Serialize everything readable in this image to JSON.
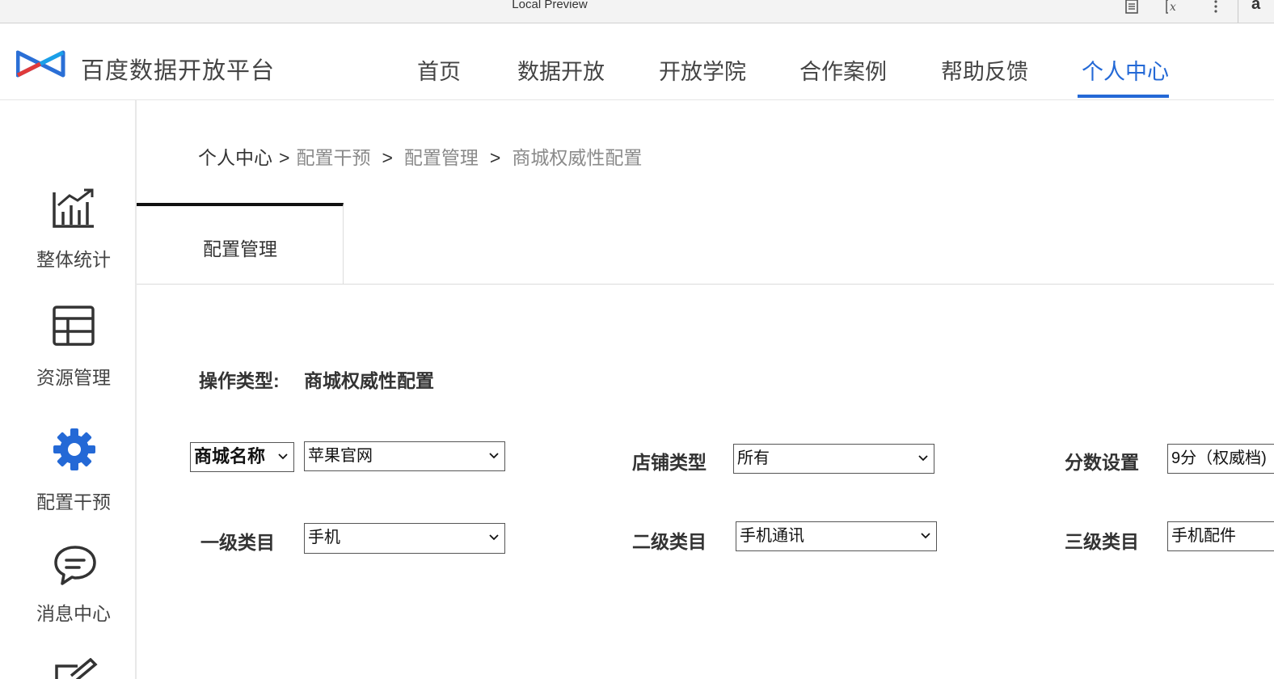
{
  "browser": {
    "title": "Local Preview",
    "corner_text": "a"
  },
  "header": {
    "brand": "百度数据开放平台",
    "nav": [
      {
        "label": "首页"
      },
      {
        "label": "数据开放"
      },
      {
        "label": "开放学院"
      },
      {
        "label": "合作案例"
      },
      {
        "label": "帮助反馈"
      },
      {
        "label": "个人中心",
        "active": true
      }
    ],
    "active_color": "#2469d6"
  },
  "sidebar": {
    "items": [
      {
        "label": "整体统计",
        "icon": "chart-icon"
      },
      {
        "label": "资源管理",
        "icon": "table-icon"
      },
      {
        "label": "配置干预",
        "icon": "gear-icon",
        "active": true
      },
      {
        "label": "消息中心",
        "icon": "message-icon"
      },
      {
        "icon": "edit-icon"
      }
    ]
  },
  "breadcrumb": {
    "items": [
      "个人中心",
      "配置干预",
      "配置管理",
      "商城权威性配置"
    ],
    "separator": ">"
  },
  "tab": {
    "label": "配置管理"
  },
  "operation": {
    "label": "操作类型:",
    "value": "商城权威性配置"
  },
  "filters": {
    "mall_key": "商城名称",
    "mall_value": "苹果官网",
    "shop_type_label": "店铺类型",
    "shop_type_value": "所有",
    "score_label": "分数设置",
    "score_value": "9分（权威档)",
    "cat1_label": "一级类目",
    "cat1_value": "手机",
    "cat2_label": "二级类目",
    "cat2_value": "手机通讯",
    "cat3_label": "三级类目",
    "cat3_value": "手机配件"
  }
}
